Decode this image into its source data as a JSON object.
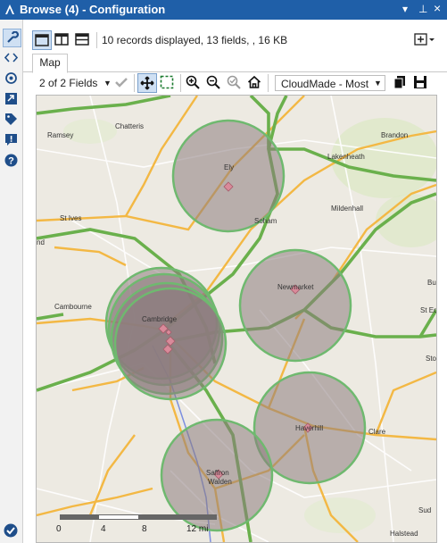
{
  "window": {
    "title": "Browse (4) - Configuration",
    "controls": {
      "menu": "▾",
      "pin": "⊥",
      "close": "×"
    }
  },
  "sidebar": {
    "items": [
      {
        "name": "configuration-icon",
        "selected": true
      },
      {
        "name": "annotation-icon",
        "selected": false
      },
      {
        "name": "connection-icon",
        "selected": false
      },
      {
        "name": "metainfo-icon",
        "selected": false
      },
      {
        "name": "tag-icon",
        "selected": false
      },
      {
        "name": "messages-icon",
        "selected": false
      },
      {
        "name": "help-icon",
        "selected": false
      }
    ]
  },
  "toolbar": {
    "records_text": "10 records displayed, 13 fields, , 16 KB"
  },
  "tabs": [
    {
      "label": "Map"
    }
  ],
  "map_toolbar": {
    "fields_label": "2 of 2 Fields",
    "basemap_value": "CloudMade - Most"
  },
  "map": {
    "places": [
      {
        "label": "Chatteris"
      },
      {
        "label": "Ramsey"
      },
      {
        "label": "Brandon"
      },
      {
        "label": "Lakenheath"
      },
      {
        "label": "Ely"
      },
      {
        "label": "Mildenhall"
      },
      {
        "label": "St Ives"
      },
      {
        "label": "Soham"
      },
      {
        "label": "Newmarket"
      },
      {
        "label": "Cambourne"
      },
      {
        "label": "Cambridge"
      },
      {
        "label": "Haverhill"
      },
      {
        "label": "Clare"
      },
      {
        "label": "Saffron"
      },
      {
        "label": "Walden"
      },
      {
        "label": "Halstead"
      },
      {
        "label": "Bu"
      },
      {
        "label": "St Ed"
      },
      {
        "label": "Sto"
      },
      {
        "label": "Sud"
      },
      {
        "label": "nd"
      }
    ],
    "scale": {
      "ticks": [
        "0",
        "4",
        "8",
        "12 mi"
      ]
    }
  }
}
